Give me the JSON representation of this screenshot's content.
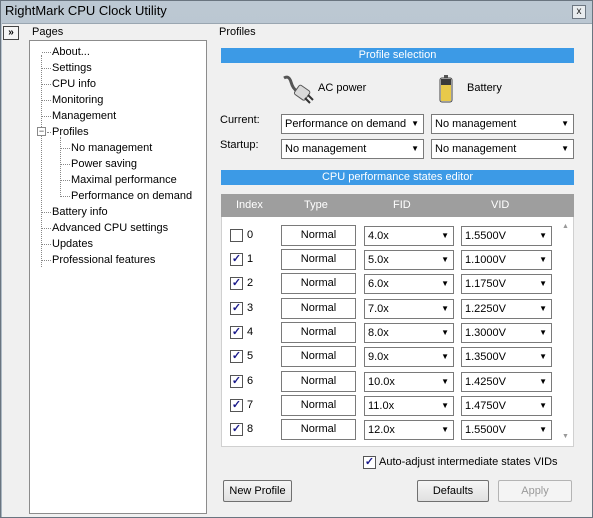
{
  "window": {
    "title": "RightMark CPU Clock Utility",
    "close_glyph": "x"
  },
  "left_panel": {
    "collapse_glyph": "»",
    "header": "Pages",
    "tree": {
      "about": "About...",
      "settings": "Settings",
      "cpu_info": "CPU info",
      "monitoring": "Monitoring",
      "management": "Management",
      "profiles": "Profiles",
      "profiles_expander": "−",
      "no_management": "No management",
      "power_saving": "Power saving",
      "maximal_performance": "Maximal performance",
      "performance_on_demand": "Performance on demand",
      "battery_info": "Battery info",
      "advanced_cpu_settings": "Advanced CPU settings",
      "updates": "Updates",
      "professional_features": "Professional features"
    }
  },
  "profiles_panel": {
    "header": "Profiles",
    "profile_selection_title": "Profile selection",
    "ac_power_label": "AC power",
    "battery_label": "Battery",
    "current_label": "Current:",
    "startup_label": "Startup:",
    "current_ac": "Performance on demand",
    "current_battery": "No management",
    "startup_ac": "No management",
    "startup_battery": "No management",
    "dropdown_arrow": "▼",
    "editor_title": "CPU performance states editor",
    "columns": {
      "index": "Index",
      "type": "Type",
      "fid": "FID",
      "vid": "VID"
    },
    "states": [
      {
        "index": "0",
        "type": "Normal",
        "fid": "4.0x",
        "vid": "1.5500V",
        "checked": false
      },
      {
        "index": "1",
        "type": "Normal",
        "fid": "5.0x",
        "vid": "1.1000V",
        "checked": true
      },
      {
        "index": "2",
        "type": "Normal",
        "fid": "6.0x",
        "vid": "1.1750V",
        "checked": true
      },
      {
        "index": "3",
        "type": "Normal",
        "fid": "7.0x",
        "vid": "1.2250V",
        "checked": true
      },
      {
        "index": "4",
        "type": "Normal",
        "fid": "8.0x",
        "vid": "1.3000V",
        "checked": true
      },
      {
        "index": "5",
        "type": "Normal",
        "fid": "9.0x",
        "vid": "1.3500V",
        "checked": true
      },
      {
        "index": "6",
        "type": "Normal",
        "fid": "10.0x",
        "vid": "1.4250V",
        "checked": true
      },
      {
        "index": "7",
        "type": "Normal",
        "fid": "11.0x",
        "vid": "1.4750V",
        "checked": true
      },
      {
        "index": "8",
        "type": "Normal",
        "fid": "12.0x",
        "vid": "1.5500V",
        "checked": true
      }
    ],
    "check_glyph": "✓",
    "scroll_up_glyph": "▲",
    "scroll_down_glyph": "▼",
    "auto_adjust_label": "Auto-adjust intermediate states VIDs",
    "auto_adjust_checked": true,
    "new_profile_button": "New Profile",
    "defaults_button": "Defaults",
    "apply_button": "Apply"
  }
}
